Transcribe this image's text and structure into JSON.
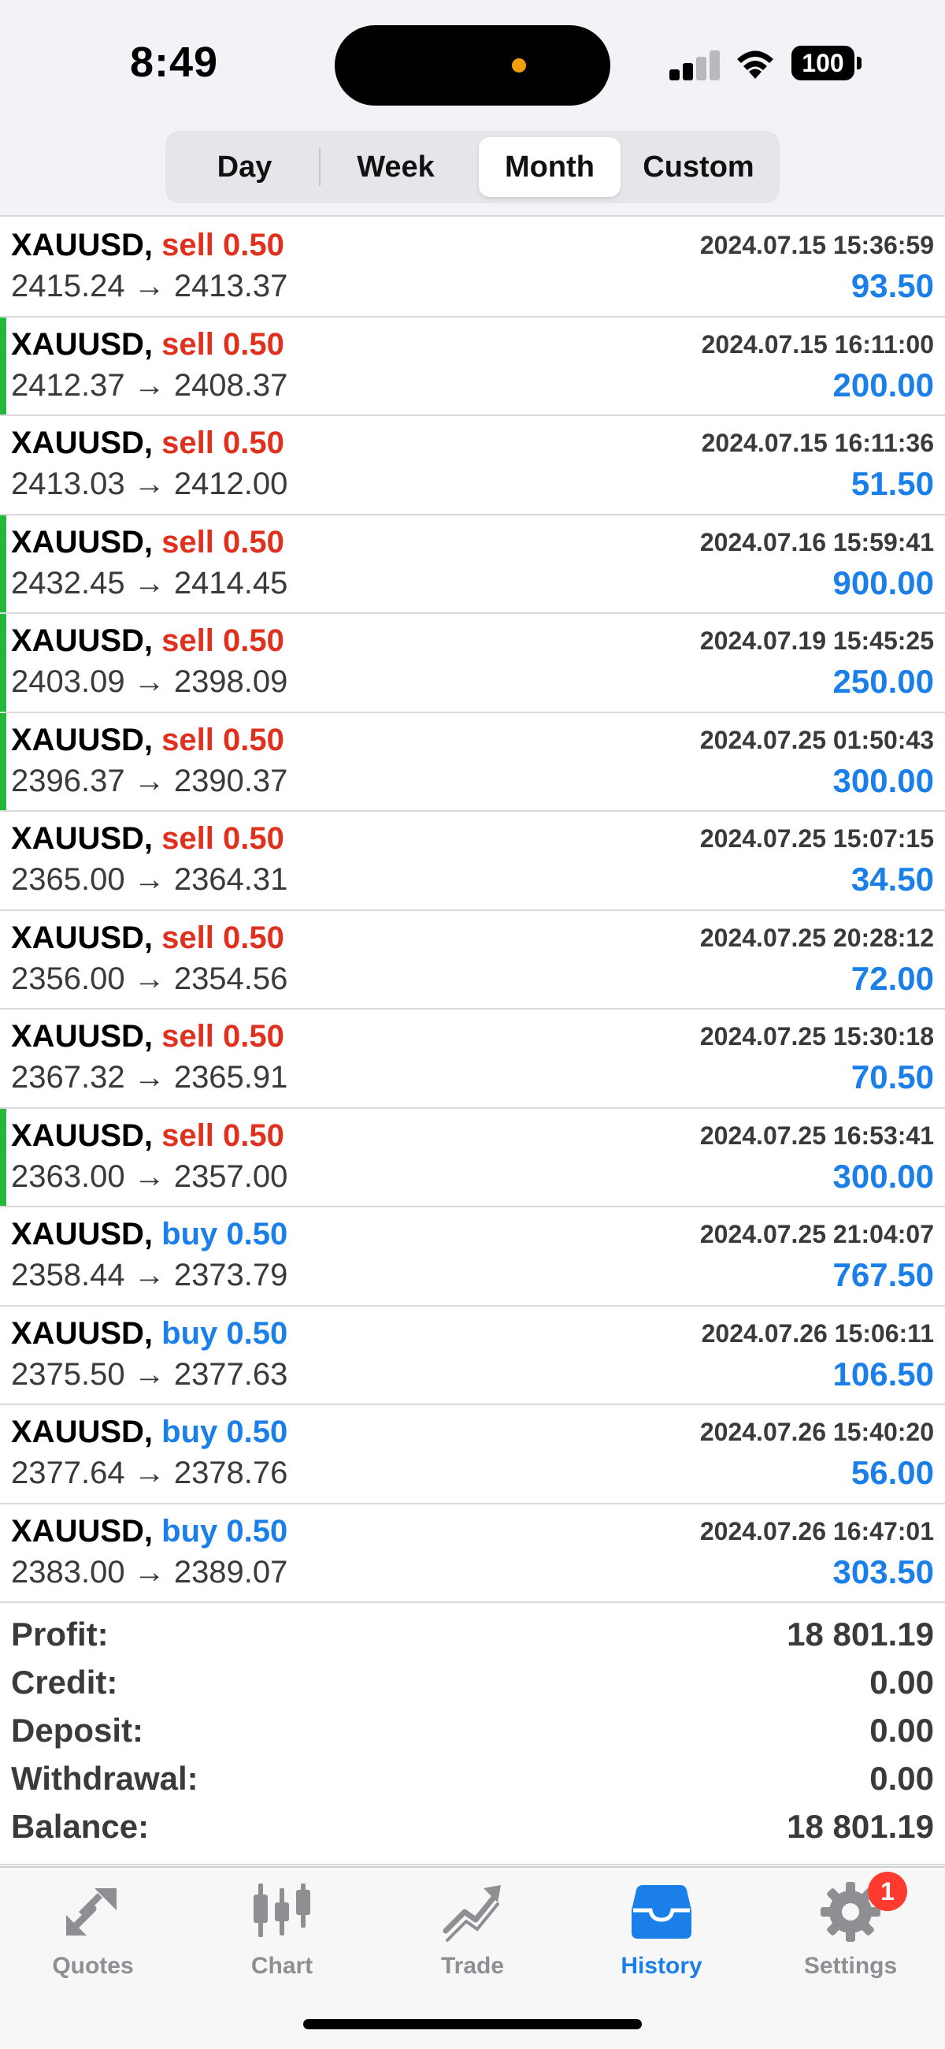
{
  "status_bar": {
    "time": "8:49",
    "battery": "100"
  },
  "period_tabs": [
    {
      "label": "Day",
      "active": false
    },
    {
      "label": "Week",
      "active": false
    },
    {
      "label": "Month",
      "active": true
    },
    {
      "label": "Custom",
      "active": false
    }
  ],
  "deals": [
    {
      "symbol": "XAUUSD,",
      "side": "sell",
      "volume": "sell 0.50",
      "prices": "2415.24 → 2413.37",
      "time": "2024.07.15 15:36:59",
      "profit": "93.50",
      "indicator": false
    },
    {
      "symbol": "XAUUSD,",
      "side": "sell",
      "volume": "sell 0.50",
      "prices": "2412.37 → 2408.37",
      "time": "2024.07.15 16:11:00",
      "profit": "200.00",
      "indicator": true
    },
    {
      "symbol": "XAUUSD,",
      "side": "sell",
      "volume": "sell 0.50",
      "prices": "2413.03 → 2412.00",
      "time": "2024.07.15 16:11:36",
      "profit": "51.50",
      "indicator": false
    },
    {
      "symbol": "XAUUSD,",
      "side": "sell",
      "volume": "sell 0.50",
      "prices": "2432.45 → 2414.45",
      "time": "2024.07.16 15:59:41",
      "profit": "900.00",
      "indicator": true
    },
    {
      "symbol": "XAUUSD,",
      "side": "sell",
      "volume": "sell 0.50",
      "prices": "2403.09 → 2398.09",
      "time": "2024.07.19 15:45:25",
      "profit": "250.00",
      "indicator": true
    },
    {
      "symbol": "XAUUSD,",
      "side": "sell",
      "volume": "sell 0.50",
      "prices": "2396.37 → 2390.37",
      "time": "2024.07.25 01:50:43",
      "profit": "300.00",
      "indicator": true
    },
    {
      "symbol": "XAUUSD,",
      "side": "sell",
      "volume": "sell 0.50",
      "prices": "2365.00 → 2364.31",
      "time": "2024.07.25 15:07:15",
      "profit": "34.50",
      "indicator": false
    },
    {
      "symbol": "XAUUSD,",
      "side": "sell",
      "volume": "sell 0.50",
      "prices": "2356.00 → 2354.56",
      "time": "2024.07.25 20:28:12",
      "profit": "72.00",
      "indicator": false
    },
    {
      "symbol": "XAUUSD,",
      "side": "sell",
      "volume": "sell 0.50",
      "prices": "2367.32 → 2365.91",
      "time": "2024.07.25 15:30:18",
      "profit": "70.50",
      "indicator": false
    },
    {
      "symbol": "XAUUSD,",
      "side": "sell",
      "volume": "sell 0.50",
      "prices": "2363.00 → 2357.00",
      "time": "2024.07.25 16:53:41",
      "profit": "300.00",
      "indicator": true
    },
    {
      "symbol": "XAUUSD,",
      "side": "buy",
      "volume": "buy 0.50",
      "prices": "2358.44 → 2373.79",
      "time": "2024.07.25 21:04:07",
      "profit": "767.50",
      "indicator": false
    },
    {
      "symbol": "XAUUSD,",
      "side": "buy",
      "volume": "buy 0.50",
      "prices": "2375.50 → 2377.63",
      "time": "2024.07.26 15:06:11",
      "profit": "106.50",
      "indicator": false
    },
    {
      "symbol": "XAUUSD,",
      "side": "buy",
      "volume": "buy 0.50",
      "prices": "2377.64 → 2378.76",
      "time": "2024.07.26 15:40:20",
      "profit": "56.00",
      "indicator": false
    },
    {
      "symbol": "XAUUSD,",
      "side": "buy",
      "volume": "buy 0.50",
      "prices": "2383.00 → 2389.07",
      "time": "2024.07.26 16:47:01",
      "profit": "303.50",
      "indicator": false
    }
  ],
  "summary": {
    "profit_label": "Profit:",
    "profit_value": "18 801.19",
    "credit_label": "Credit:",
    "credit_value": "0.00",
    "deposit_label": "Deposit:",
    "deposit_value": "0.00",
    "withdrawal_label": "Withdrawal:",
    "withdrawal_value": "0.00",
    "balance_label": "Balance:",
    "balance_value": "18 801.19"
  },
  "tabbar": {
    "quotes": "Quotes",
    "chart": "Chart",
    "trade": "Trade",
    "history": "History",
    "settings": "Settings",
    "settings_badge": "1",
    "active_tab": "History"
  },
  "colors": {
    "sell": "#e0301e",
    "buy": "#1a7fe8",
    "profit": "#1a7fe8",
    "indicator": "#22b83a",
    "active_tab": "#1a7fe8"
  }
}
